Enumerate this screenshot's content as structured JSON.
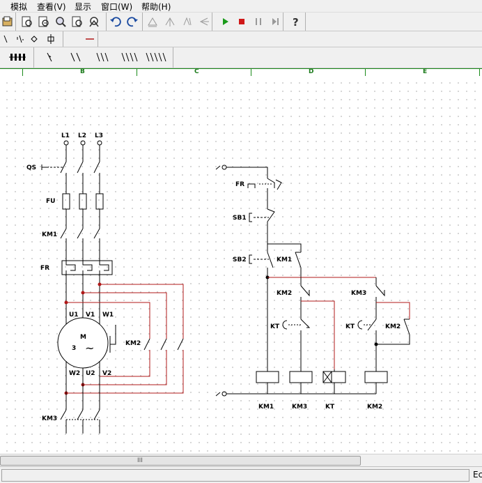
{
  "menu": {
    "items": [
      {
        "label": "模拟"
      },
      {
        "label": "查看(V)"
      },
      {
        "label": "显示"
      },
      {
        "label": "窗口(W)"
      },
      {
        "label": "帮助(H)"
      }
    ]
  },
  "toolbar": {
    "icons": [
      "open-icon",
      "print-preview-icon",
      "zoom-in-icon",
      "zoom-out-icon",
      "find-icon",
      "undo-icon",
      "redo-icon",
      "align-icon",
      "mirror-icon",
      "rotate-icon",
      "flip-icon",
      "run-icon",
      "stop-icon",
      "pause-icon",
      "step-icon",
      "help-icon"
    ],
    "colors": {
      "run": "#1a9a1a",
      "stop": "#d01818",
      "wire": "#b01818",
      "grid": "#1a8a1a"
    }
  },
  "ruler": {
    "columns": [
      "B",
      "C",
      "D",
      "E"
    ]
  },
  "diagram": {
    "main": {
      "phases": [
        "L1",
        "L2",
        "L3"
      ],
      "qs": "QS",
      "fu": "FU",
      "km1": "KM1",
      "fr": "FR",
      "terminals_top": [
        "U1",
        "V1",
        "W1"
      ],
      "motor_label": "M",
      "motor_phase": "3",
      "motor_symbol": "~",
      "terminals_bottom": [
        "W2",
        "U2",
        "V2"
      ],
      "km2": "KM2",
      "km3": "KM3"
    },
    "control": {
      "fr": "FR",
      "sb1": "SB1",
      "sb2": "SB2",
      "km1_contact": "KM1",
      "km2_contact": "KM2",
      "km3_contact": "KM3",
      "kt1": "KT",
      "kt2": "KT",
      "km2_hold": "KM2",
      "coils": [
        "KM1",
        "KM3",
        "KT",
        "KM2"
      ]
    }
  },
  "scroll": {
    "grip": "III"
  },
  "status": {
    "text": "Ec"
  }
}
